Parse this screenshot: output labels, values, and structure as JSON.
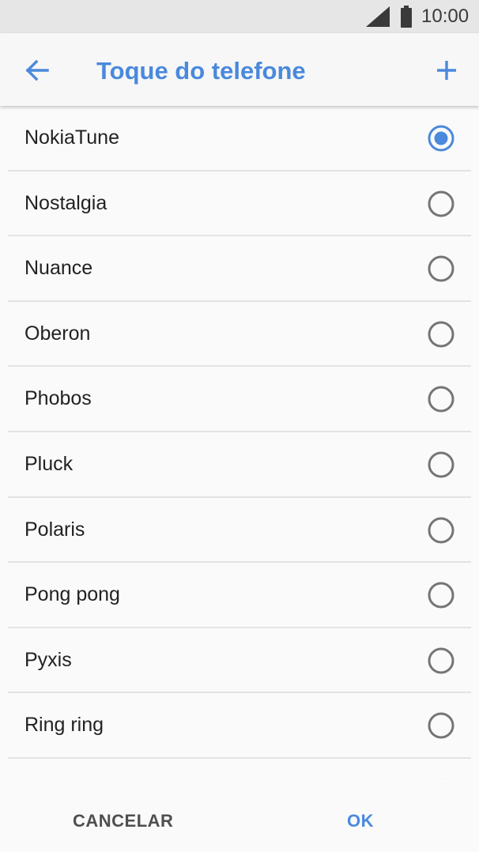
{
  "status_bar": {
    "time": "10:00",
    "icons": [
      "cell-signal-icon",
      "battery-icon"
    ]
  },
  "app_bar": {
    "title": "Toque do telefone",
    "back_icon": "arrow-left-icon",
    "add_icon": "plus-icon"
  },
  "ringtones": [
    {
      "label": "NokiaTune",
      "selected": true
    },
    {
      "label": "Nostalgia",
      "selected": false
    },
    {
      "label": "Nuance",
      "selected": false
    },
    {
      "label": "Oberon",
      "selected": false
    },
    {
      "label": "Phobos",
      "selected": false
    },
    {
      "label": "Pluck",
      "selected": false
    },
    {
      "label": "Polaris",
      "selected": false
    },
    {
      "label": "Pong pong",
      "selected": false
    },
    {
      "label": "Pyxis",
      "selected": false
    },
    {
      "label": "Ring ring",
      "selected": false
    }
  ],
  "footer": {
    "cancel_label": "CANCELAR",
    "ok_label": "OK"
  },
  "colors": {
    "accent": "#4a89dc",
    "radio_unselected": "#757575",
    "status_bar_bg": "#e6e6e6"
  }
}
